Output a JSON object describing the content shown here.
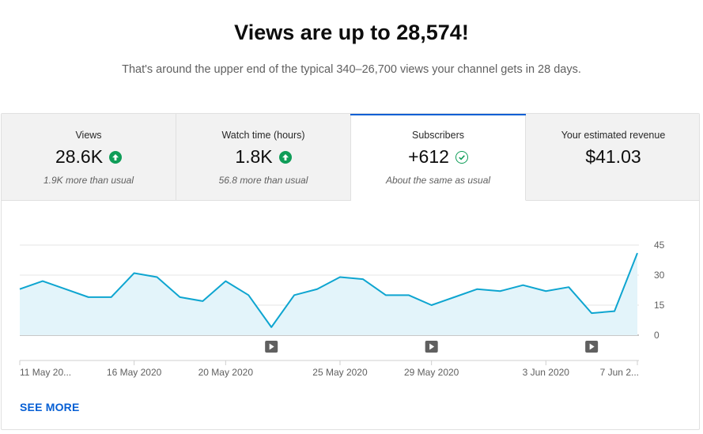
{
  "header": {
    "title": "Views are up to 28,574!",
    "subtitle": "That's around the upper end of the typical 340–26,700 views your channel gets in 28 days."
  },
  "tabs": [
    {
      "label": "Views",
      "value": "28.6K",
      "note": "1.9K more than usual",
      "icon": "arrow-up-circle-icon",
      "active": false
    },
    {
      "label": "Watch time (hours)",
      "value": "1.8K",
      "note": "56.8 more than usual",
      "icon": "arrow-up-circle-icon",
      "active": false
    },
    {
      "label": "Subscribers",
      "value": "+612",
      "note": "About the same as usual",
      "icon": "check-circle-icon",
      "active": true
    },
    {
      "label": "Your estimated revenue",
      "value": "$41.03",
      "note": "",
      "icon": "",
      "active": false
    }
  ],
  "colors": {
    "accent": "#065fd4",
    "line": "#0ea5d0",
    "fill": "#e3f4fa",
    "positive": "#0f9d58"
  },
  "chart_data": {
    "type": "area",
    "series": [
      {
        "values": [
          23,
          27,
          23,
          19,
          19,
          31,
          29,
          19,
          17,
          27,
          20,
          4,
          20,
          23,
          29,
          28,
          20,
          20,
          15,
          19,
          23,
          22,
          25,
          22,
          24,
          11,
          12,
          41
        ]
      }
    ],
    "ylim": [
      0,
      45
    ],
    "yticks": [
      "45",
      "30",
      "15",
      "0"
    ],
    "xticks": [
      "11 May 20...",
      "16 May 2020",
      "20 May 2020",
      "25 May 2020",
      "29 May 2020",
      "3 Jun 2020",
      "7 Jun 2..."
    ],
    "xtick_index": [
      0,
      5,
      9,
      14,
      18,
      23,
      27
    ],
    "video_markers_index": [
      11,
      18,
      25
    ],
    "grid": true
  },
  "footer": {
    "see_more": "SEE MORE"
  }
}
